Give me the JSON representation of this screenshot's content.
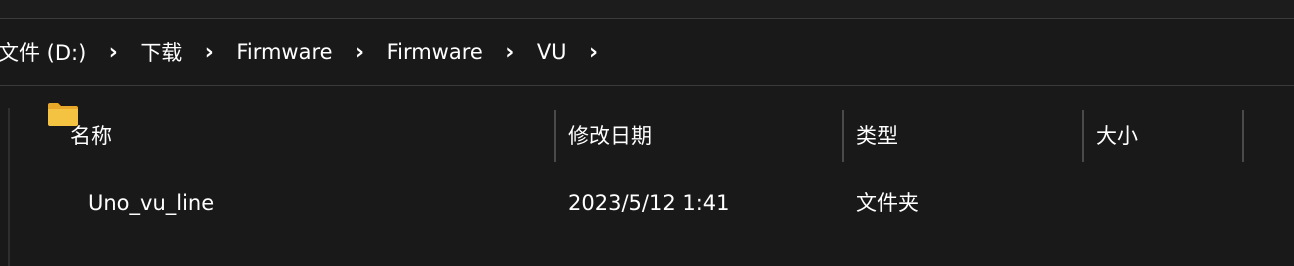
{
  "breadcrumb": {
    "items": [
      "文件 (D:)",
      "下载",
      "Firmware",
      "Firmware",
      "VU"
    ],
    "separator": "›"
  },
  "columns": [
    {
      "label": "名称",
      "sort": "ascending"
    },
    {
      "label": "修改日期"
    },
    {
      "label": "类型"
    },
    {
      "label": "大小"
    }
  ],
  "rows": [
    {
      "icon": "folder-icon",
      "name": "Uno_vu_line",
      "modified": "2023/5/12 1:41",
      "type": "文件夹",
      "size": ""
    }
  ],
  "colors": {
    "background": "#191919",
    "text": "#ffffff",
    "divider": "#4a4a4a",
    "folder": "#f5c342"
  }
}
